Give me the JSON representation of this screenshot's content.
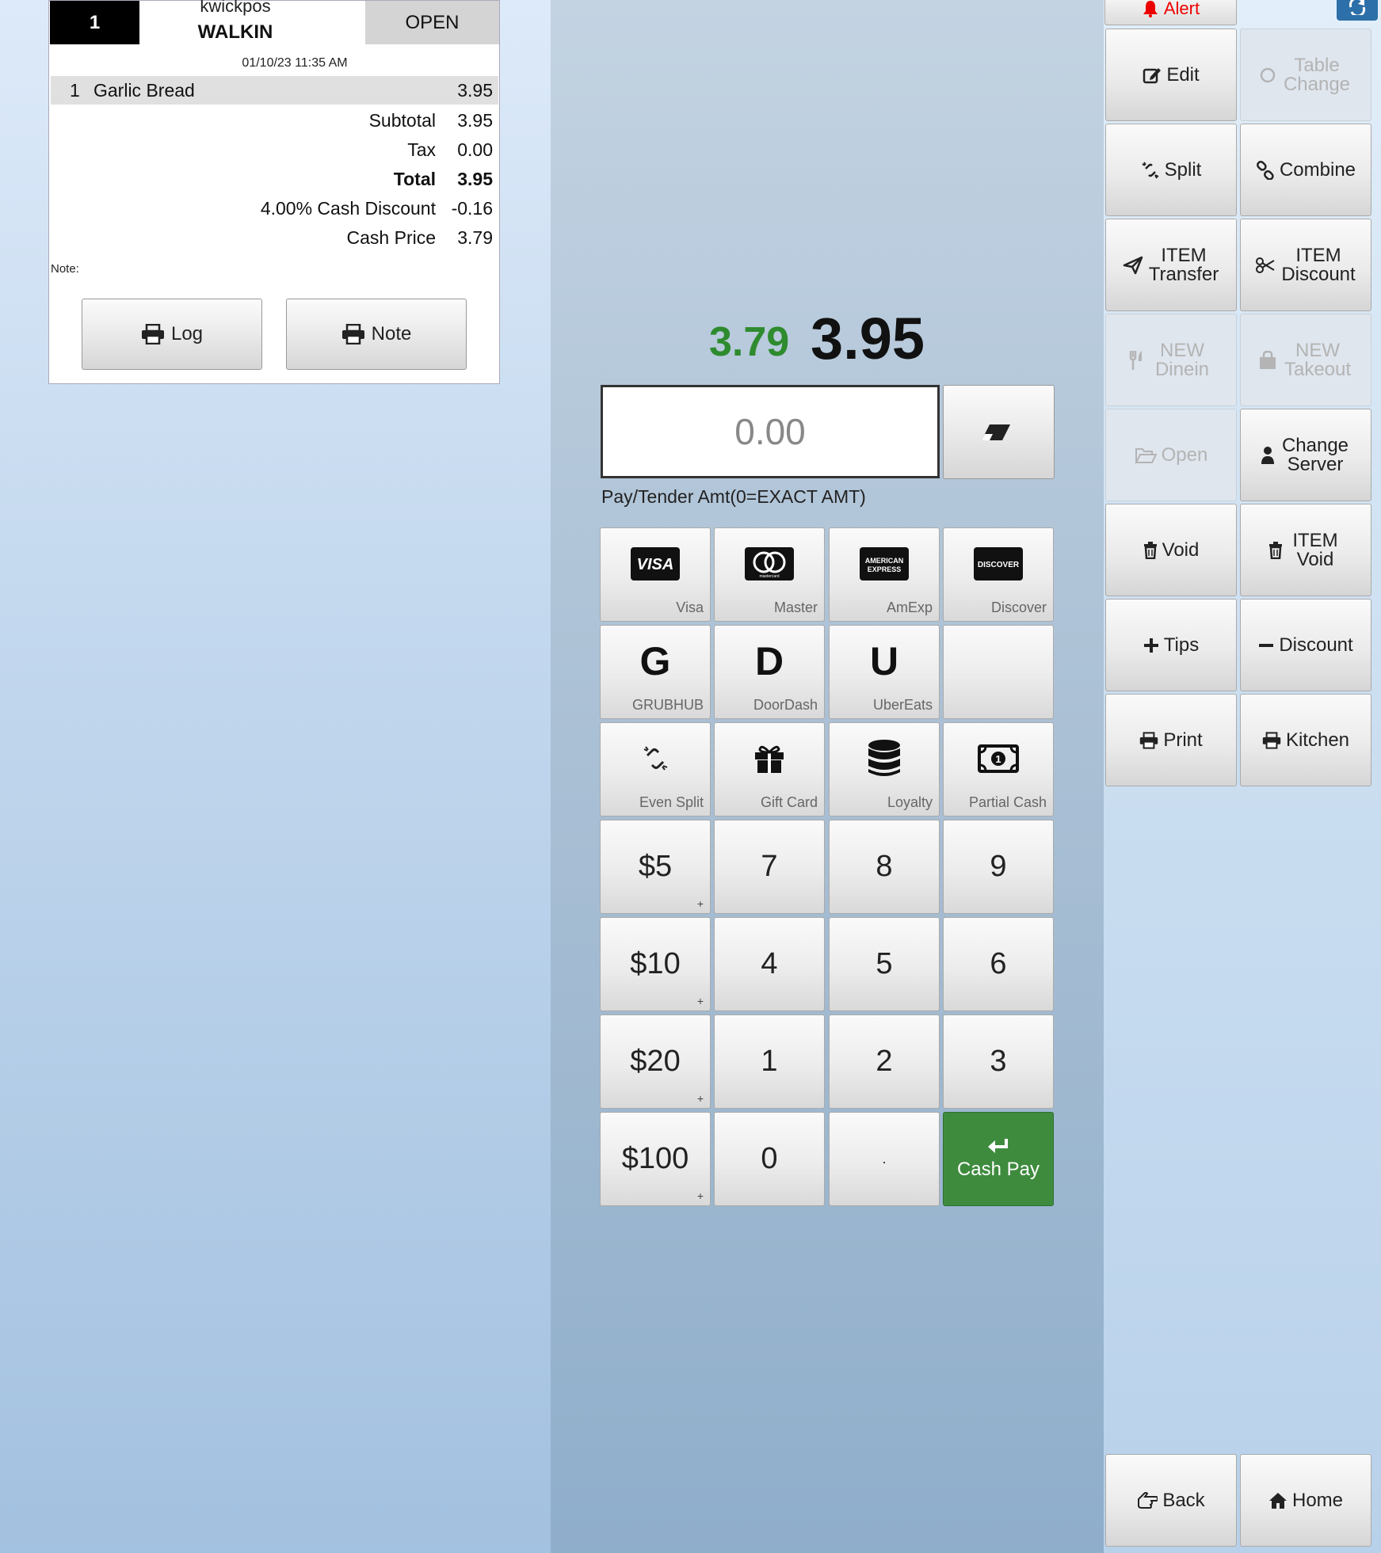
{
  "ticket": {
    "number": "1",
    "owner": "kwickpos",
    "type": "WALKIN",
    "status": "OPEN",
    "datetime": "01/10/23 11:35 AM",
    "items": [
      {
        "qty": "1",
        "name": "Garlic Bread",
        "price": "3.95"
      }
    ],
    "subtotal_label": "Subtotal",
    "subtotal": "3.95",
    "tax_label": "Tax",
    "tax": "0.00",
    "total_label": "Total",
    "total": "3.95",
    "discount_label": "4.00% Cash Discount",
    "discount": "-0.16",
    "cash_price_label": "Cash Price",
    "cash_price": "3.79",
    "note_label": "Note:",
    "log_button": "Log",
    "note_button": "Note"
  },
  "payment": {
    "cash_amount": "3.79",
    "total_amount": "3.95",
    "tender_value": "0.00",
    "tender_label": "Pay/Tender Amt(0=EXACT AMT)",
    "cards": [
      {
        "label": "Visa",
        "icon": "visa-card-icon"
      },
      {
        "label": "Master",
        "icon": "mastercard-icon"
      },
      {
        "label": "AmExp",
        "icon": "amex-card-icon"
      },
      {
        "label": "Discover",
        "icon": "discover-card-icon"
      }
    ],
    "delivery": [
      {
        "letter": "G",
        "label": "GRUBHUB"
      },
      {
        "letter": "D",
        "label": "DoorDash"
      },
      {
        "letter": "U",
        "label": "UberEats"
      }
    ],
    "other": [
      {
        "label": "Even Split",
        "icon": "split-icon"
      },
      {
        "label": "Gift Card",
        "icon": "gift-icon"
      },
      {
        "label": "Loyalty",
        "icon": "database-icon"
      },
      {
        "label": "Partial Cash",
        "icon": "money-icon"
      }
    ],
    "quick_cash": [
      "$5",
      "$10",
      "$20",
      "$100"
    ],
    "quick_plus": "+",
    "keys": {
      "seven": "7",
      "eight": "8",
      "nine": "9",
      "four": "4",
      "five": "5",
      "six": "6",
      "one": "1",
      "two": "2",
      "three": "3",
      "zero": "0",
      "dot": "."
    },
    "cash_pay": "Cash Pay"
  },
  "actions": {
    "alert": "Alert",
    "edit": "Edit",
    "table_change": "Table Change",
    "split": "Split",
    "combine": "Combine",
    "item_transfer": "ITEM Transfer",
    "item_discount": "ITEM Discount",
    "new_dinein": "NEW Dinein",
    "new_takeout": "NEW Takeout",
    "open": "Open",
    "change_server": "Change Server",
    "void": "Void",
    "item_void": "ITEM Void",
    "tips": "Tips",
    "discount": "Discount",
    "print": "Print",
    "kitchen": "Kitchen",
    "back": "Back",
    "home": "Home"
  },
  "colors": {
    "cash_green": "#2e8b2e",
    "cash_pay_bg": "#3e8b3e",
    "alert_red": "#e00000",
    "refresh_blue": "#2d6fa8"
  }
}
